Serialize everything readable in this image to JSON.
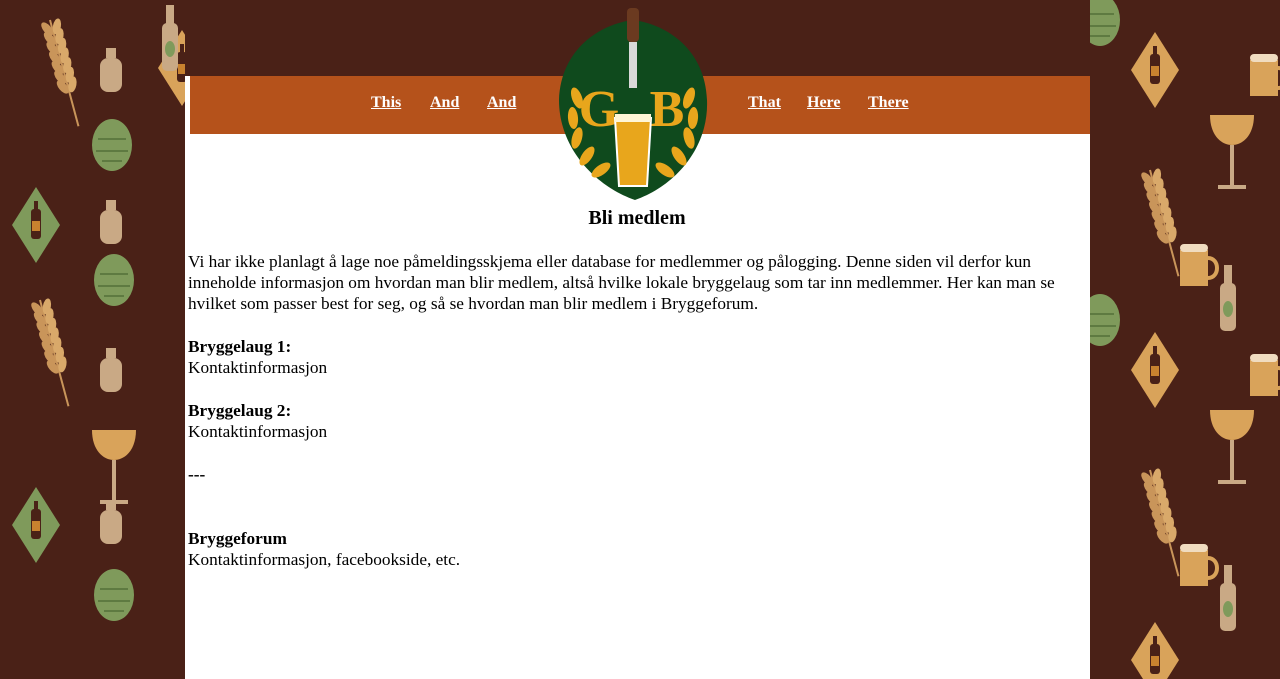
{
  "colors": {
    "background": "#4a2117",
    "navbar": "#b5521b",
    "logo_green": "#0f4a1d",
    "logo_gold": "#e8a61c",
    "nav_text": "#ffffff"
  },
  "logo": {
    "letters_left": "G",
    "letters_right": "B"
  },
  "nav": {
    "left": [
      "This",
      "And",
      "And"
    ],
    "right": [
      "That",
      "Here",
      "There"
    ]
  },
  "main": {
    "title": "Bli medlem",
    "intro": "Vi har ikke planlagt å lage noe påmeldingsskjema eller database for medlemmer og pålogging. Denne siden vil derfor kun inneholde informasjon om hvordan man blir medlem, altså hvilke lokale bryggelaug som tar inn medlemmer. Her kan man se hvilket som passer best for seg, og så se hvordan man blir medlem i Bryggeforum.",
    "sections": [
      {
        "heading": "Bryggelaug 1:",
        "text": "Kontaktinformasjon"
      },
      {
        "heading": "Bryggelaug 2:",
        "text": "Kontaktinformasjon"
      }
    ],
    "separator": "---",
    "forum": {
      "heading": "Bryggeforum",
      "text": "Kontaktinformasjon, facebookside, etc."
    }
  }
}
